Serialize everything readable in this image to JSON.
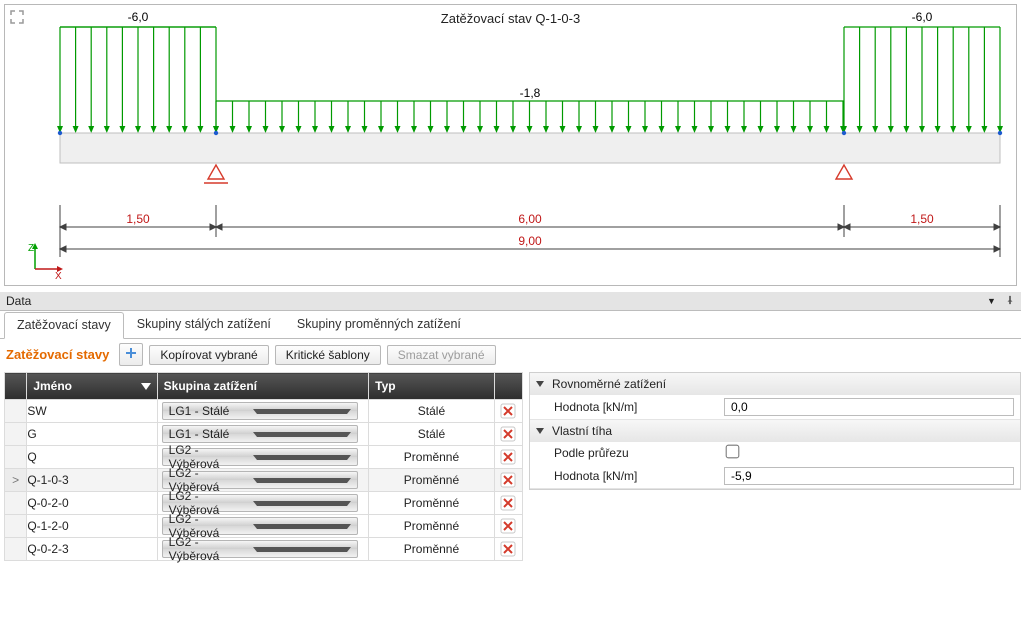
{
  "viewport": {
    "title": "Zatěžovací stav Q-1-0-3",
    "left_load_label": "-6,0",
    "right_load_label": "-6,0",
    "mid_load_label": "-1,8",
    "dims": {
      "left": "1,50",
      "mid": "6,00",
      "right": "1,50",
      "total": "9,00"
    }
  },
  "panels": {
    "data_header": "Data"
  },
  "tabs": {
    "states": "Zatěžovací stavy",
    "perm_groups": "Skupiny stálých zatížení",
    "var_groups": "Skupiny proměnných zatížení"
  },
  "toolbar": {
    "title": "Zatěžovací stavy",
    "copy": "Kopírovat vybrané",
    "critical": "Kritické šablony",
    "delete": "Smazat vybrané"
  },
  "grid": {
    "cols": {
      "name": "Jméno",
      "group": "Skupina zatížení",
      "type": "Typ"
    },
    "group_options": {
      "lg1": "LG1 - Stálé",
      "lg2": "LG2 - Výběrová"
    },
    "type_options": {
      "perm": "Stálé",
      "var": "Proměnné"
    },
    "rows": [
      {
        "name": "SW",
        "group": "LG1 - Stálé",
        "type": "Stálé",
        "selected": false
      },
      {
        "name": "G",
        "group": "LG1 - Stálé",
        "type": "Stálé",
        "selected": false
      },
      {
        "name": "Q",
        "group": "LG2 - Výběrová",
        "type": "Proměnné",
        "selected": false
      },
      {
        "name": "Q-1-0-3",
        "group": "LG2 - Výběrová",
        "type": "Proměnné",
        "selected": true
      },
      {
        "name": "Q-0-2-0",
        "group": "LG2 - Výběrová",
        "type": "Proměnné",
        "selected": false
      },
      {
        "name": "Q-1-2-0",
        "group": "LG2 - Výběrová",
        "type": "Proměnné",
        "selected": false
      },
      {
        "name": "Q-0-2-3",
        "group": "LG2 - Výběrová",
        "type": "Proměnné",
        "selected": false
      }
    ]
  },
  "props": {
    "g1": {
      "title": "Rovnoměrné zatížení",
      "value_label": "Hodnota [kN/m]",
      "value": "0,0"
    },
    "g2": {
      "title": "Vlastní tíha",
      "cs_label": "Podle průřezu",
      "cs_checked": false,
      "value_label": "Hodnota [kN/m]",
      "value": "-5,9"
    }
  }
}
